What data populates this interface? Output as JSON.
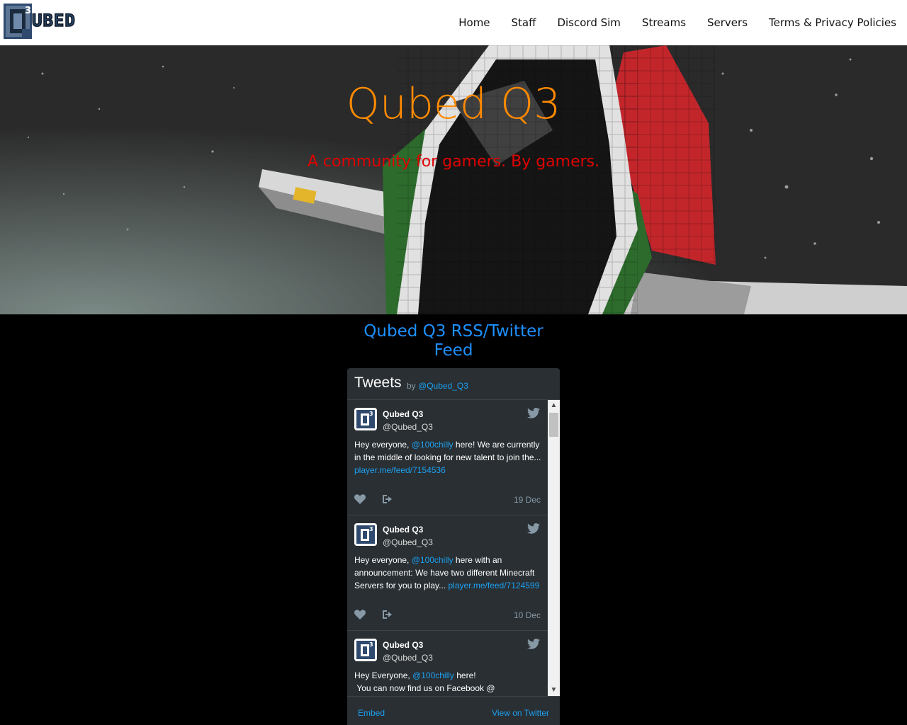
{
  "header": {
    "logo_text": "UBED",
    "nav": [
      "Home",
      "Staff",
      "Discord Sim",
      "Streams",
      "Servers",
      "Terms & Privacy Policies"
    ]
  },
  "hero": {
    "title": "Qubed Q3",
    "subtitle": "A community for gamers. By gamers."
  },
  "feed": {
    "title": "Qubed Q3 RSS/Twitter Feed",
    "widget": {
      "heading": "Tweets",
      "by_label": "by",
      "by_handle": "@Qubed_Q3",
      "tweets": [
        {
          "name": "Qubed Q3",
          "handle": "@Qubed_Q3",
          "text_pre": "Hey everyone, ",
          "mention": "@100chilly",
          "text_post": " here! We are currently in the middle of looking for new talent to join the... ",
          "link": "player.me/feed/7154536",
          "date": "19 Dec"
        },
        {
          "name": "Qubed Q3",
          "handle": "@Qubed_Q3",
          "text_pre": "Hey everyone, ",
          "mention": "@100chilly",
          "text_post": " here with an announcement: We have two different Minecraft Servers for you to play... ",
          "link": "player.me/feed/7124599",
          "date": "10 Dec"
        },
        {
          "name": "Qubed Q3",
          "handle": "@Qubed_Q3",
          "text_pre": "Hey Everyone, ",
          "mention": "@100chilly",
          "text_post": " here!\n You can now find us on Facebook @",
          "link": "",
          "date": ""
        }
      ],
      "footer_embed": "Embed",
      "footer_view": "View on Twitter"
    }
  },
  "colors": {
    "title": "#ff8a00",
    "subtitle": "#e00000",
    "feed_title": "#1e90ff",
    "twitter_link": "#1da1f2",
    "widget_bg": "#292f33"
  },
  "icons": [
    "qubed-logo",
    "twitter-bird-icon",
    "heart-icon",
    "share-icon",
    "scroll-up-icon",
    "scroll-down-icon"
  ]
}
